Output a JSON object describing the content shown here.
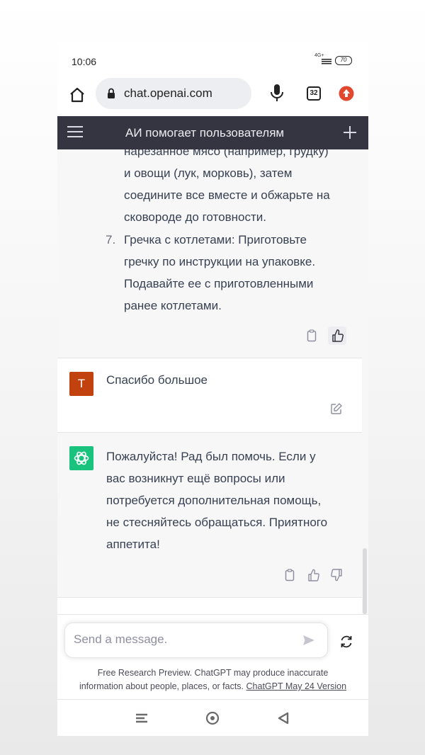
{
  "status_bar": {
    "time": "10:06",
    "network": "4G+",
    "battery": "70"
  },
  "browser": {
    "url": "chat.openai.com",
    "tab_count": "32"
  },
  "chat_header": {
    "title": "АИ помогает пользователям"
  },
  "messages": {
    "ai_previous": {
      "lines": [
        "нарезанное мясо (например, грудку)",
        "и овощи (лук, морковь), затем",
        "соедините все вместе и обжарьте на",
        "сковороде до готовности."
      ],
      "item7": {
        "number": "7.",
        "lines": [
          "Гречка с котлетами: Приготовьте",
          "гречку по инструкции на упаковке.",
          "Подавайте ее с приготовленными",
          "ранее котлетами."
        ]
      }
    },
    "user": {
      "avatar_letter": "T",
      "text": "Спасибо большое"
    },
    "ai_reply": {
      "lines": [
        "Пожалуйста! Рад был помочь. Если у",
        "вас возникнут ещё вопросы или",
        "потребуется дополнительная помощь,",
        "не стесняйтесь обращаться. Приятного",
        "аппетита!"
      ]
    }
  },
  "composer": {
    "placeholder": "Send a message."
  },
  "disclaimer": {
    "line1": "Free Research Preview. ChatGPT may produce inaccurate",
    "line2": "information about people, places, or facts.",
    "version_link": "ChatGPT May 24 Version"
  },
  "colors": {
    "header_bg": "#343541",
    "user_avatar": "#c1410f",
    "ai_avatar": "#19c37d",
    "update_badge": "#e2482d"
  }
}
